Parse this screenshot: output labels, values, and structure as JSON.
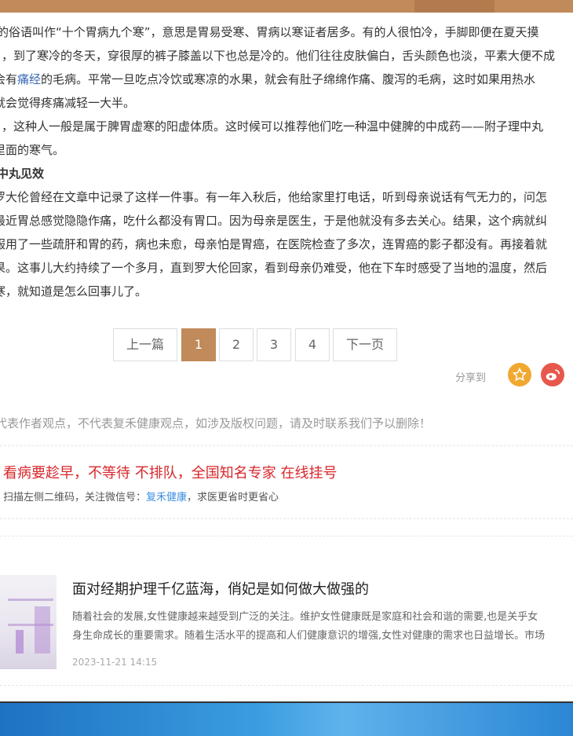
{
  "article": {
    "p1": "的俗语叫作“十个胃病九个寒”，意思是胃易受寒、胃病以寒证者居多。有的人很怕冷，手脚即便在夏天摸",
    "p2": "，到了寒冷的冬天，穿很厚的裤子膝盖以下也总是冷的。他们往往皮肤偏白，舌头颜色也淡，平素大便不成",
    "p3_a": "会有",
    "p3_link": "痛经",
    "p3_b": "的毛病。平常一旦吃点冷饮或寒凉的水果，就会有肚子绵绵作痛、腹泻的毛病，这时如果用热水",
    "p4": "就会觉得疼痛减轻一大半。",
    "p5": "，这种人一般是属于脾胃虚寒的阳虚体质。这时候可以推荐他们吃一种温中健脾的中成药——附子理中丸",
    "p6": "里面的寒气。",
    "heading": "中丸见效",
    "p7": "罗大伦曾经在文章中记录了这样一件事。有一年入秋后，他给家里打电话，听到母亲说话有气无力的，问怎",
    "p8": "最近胃总感觉隐隐作痛，吃什么都没有胃口。因为母亲是医生，于是他就没有多去关心。结果，这个病就纠",
    "p9": "服用了一些疏肝和胃的药，病也未愈，母亲怕是胃癌，在医院检查了多次，连胃癌的影子都没有。再接着就",
    "p10": "果。这事儿大约持续了一个多月，直到罗大伦回家，看到母亲仍难受，他在下车时感受了当地的温度，然后",
    "p11": "寒，就知道是怎么回事儿了。"
  },
  "pager": {
    "prev": "上一篇",
    "pages": [
      "1",
      "2",
      "3",
      "4"
    ],
    "next": "下一页",
    "active": "1"
  },
  "share": {
    "label": "分享到",
    "icons": [
      {
        "name": "star-icon",
        "color": "#f0a830"
      },
      {
        "name": "weibo-icon",
        "color": "#e8574b"
      }
    ]
  },
  "disclaimer": "代表作者观点，不代表复禾健康观点，如涉及版权问题，请及时联系我们予以删除！",
  "promo": {
    "title": "看病要趁早，不等待 不排队，全国知名专家 在线挂号",
    "sub_prefix": "扫描左侧二维码，关注微信号：",
    "sub_link": "复禾健康",
    "sub_suffix": "，求医更省时更省心"
  },
  "related": {
    "title": "面对经期护理千亿蓝海，俏妃是如何做大做强的",
    "desc1": "随着社会的发展,女性健康越来越受到广泛的关注。维护女性健康既是家庭和社会和谐的需要,也是关乎女",
    "desc2": "身生命成长的重要需求。随着生活水平的提高和人们健康意识的增强,女性对健康的需求也日益增长。市场",
    "date": "2023-11-21 14:15"
  }
}
